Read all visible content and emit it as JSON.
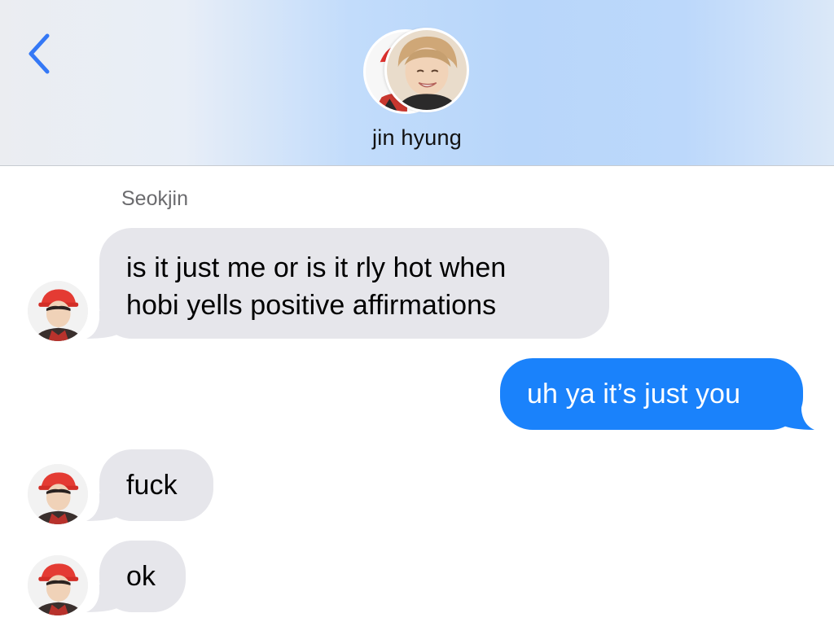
{
  "header": {
    "back_icon": "chevron-left-icon",
    "contact_name": "jin hyung",
    "accent_color": "#3478f6"
  },
  "conversation": {
    "sender_label": "Seokjin",
    "messages": [
      {
        "from": "incoming",
        "lines": [
          "is it just me or is it rly hot when",
          "hobi yells positive affirmations"
        ]
      },
      {
        "from": "outgoing",
        "text": "uh ya it’s just you"
      },
      {
        "from": "incoming",
        "text": "fuck"
      },
      {
        "from": "incoming",
        "text": "ok"
      }
    ],
    "incoming_bubble_color": "#e6e6eb",
    "outgoing_bubble_color": "#1a82fb"
  }
}
